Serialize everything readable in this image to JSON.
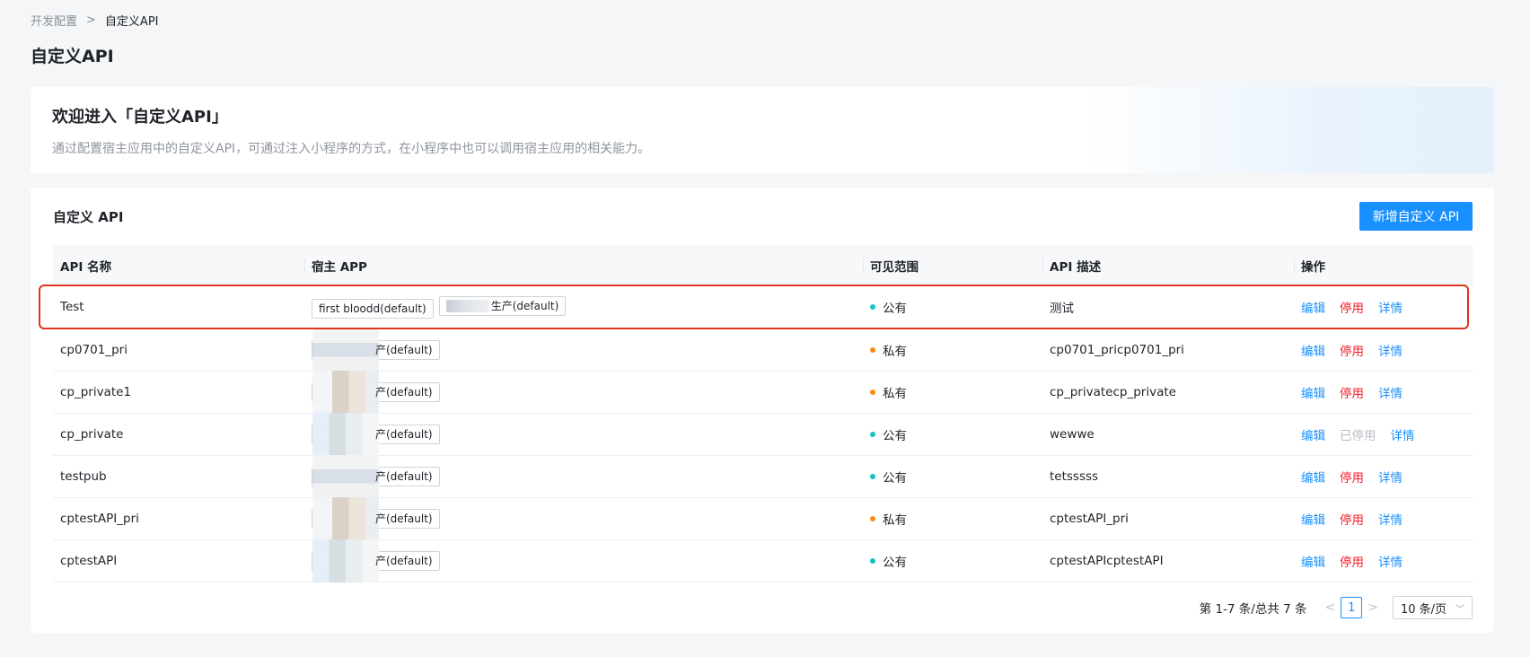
{
  "breadcrumb": {
    "parent": "开发配置",
    "separator": ">",
    "current": "自定义API"
  },
  "page_title": "自定义API",
  "welcome": {
    "title": "欢迎进入「自定义API」",
    "description": "通过配置宿主应用中的自定义API，可通过注入小程序的方式，在小程序中也可以调用宿主应用的相关能力。"
  },
  "panel": {
    "title": "自定义 API",
    "add_button": "新增自定义 API"
  },
  "table": {
    "headers": [
      "API 名称",
      "宿主 APP",
      "可见范围",
      "API 描述",
      "操作"
    ],
    "rows": [
      {
        "name": "Test",
        "tags": [
          "first bloodd(default)",
          "生产(default)"
        ],
        "visibility": "公有",
        "vis_color": "#13c2c2",
        "desc": "测试",
        "stop_label": "停用",
        "stopped": false
      },
      {
        "name": "cp0701_pri",
        "tags": [
          "产(default)"
        ],
        "visibility": "私有",
        "vis_color": "#fa8c16",
        "desc": "cp0701_pricp0701_pri",
        "stop_label": "停用",
        "stopped": false
      },
      {
        "name": "cp_private1",
        "tags": [
          "产(default)"
        ],
        "visibility": "私有",
        "vis_color": "#fa8c16",
        "desc": "cp_privatecp_private",
        "stop_label": "停用",
        "stopped": false
      },
      {
        "name": "cp_private",
        "tags": [
          "产(default)"
        ],
        "visibility": "公有",
        "vis_color": "#13c2c2",
        "desc": "wewwe",
        "stop_label": "已停用",
        "stopped": true
      },
      {
        "name": "testpub",
        "tags": [
          "产(default)"
        ],
        "visibility": "公有",
        "vis_color": "#13c2c2",
        "desc": "tetsssss",
        "stop_label": "停用",
        "stopped": false
      },
      {
        "name": "cptestAPI_pri",
        "tags": [
          "产(default)"
        ],
        "visibility": "私有",
        "vis_color": "#fa8c16",
        "desc": "cptestAPI_pri",
        "stop_label": "停用",
        "stopped": false
      },
      {
        "name": "cptestAPI",
        "tags": [
          "产(default)"
        ],
        "visibility": "公有",
        "vis_color": "#13c2c2",
        "desc": "cptestAPIcptestAPI",
        "stop_label": "停用",
        "stopped": false
      }
    ],
    "edit_label": "编辑",
    "detail_label": "详情"
  },
  "pagination": {
    "total_text": "第 1-7 条/总共 7 条",
    "prev": "<",
    "current_page": "1",
    "next": ">",
    "page_size": "10 条/页"
  },
  "colors": {
    "primary": "#1890ff",
    "danger": "#f5222d",
    "public": "#13c2c2",
    "private": "#fa8c16",
    "highlight": "#e0331f"
  }
}
